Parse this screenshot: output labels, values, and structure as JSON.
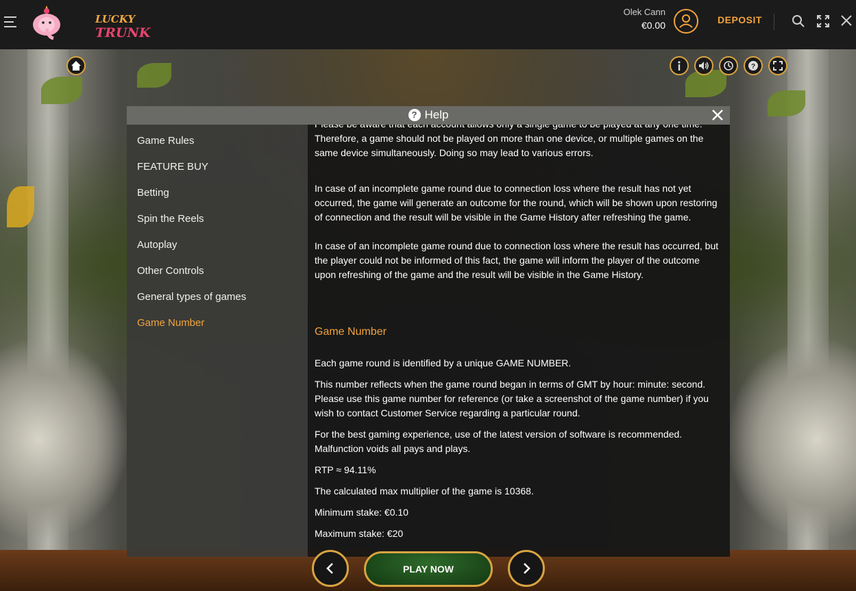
{
  "header": {
    "logo_line1": "LUCKY",
    "logo_line2": "TRUNK",
    "user_name": "Olek Cann",
    "balance": "€0.00",
    "deposit_label": "DEPOSIT"
  },
  "game_icons": {
    "home": "home-icon",
    "right": [
      "info-icon",
      "sound-icon",
      "history-icon",
      "help-icon",
      "fullscreen-icon"
    ]
  },
  "help": {
    "title": "Help",
    "nav": [
      {
        "label": "Game Rules",
        "active": false
      },
      {
        "label": "FEATURE BUY",
        "active": false
      },
      {
        "label": "Betting",
        "active": false
      },
      {
        "label": "Spin the Reels",
        "active": false
      },
      {
        "label": "Autoplay",
        "active": false
      },
      {
        "label": "Other Controls",
        "active": false
      },
      {
        "label": "General types of games",
        "active": false
      },
      {
        "label": "Game Number",
        "active": true
      }
    ],
    "content": {
      "p_partial": "Please be aware that each account allows only a single game to be played at any one time. Therefore, a game should not be played on more than one device, or multiple games on the same device simultaneously. Doing so may lead to various errors.",
      "p_incomplete_1": "In case of an incomplete game round due to connection loss where the result has not yet occurred, the game will generate an outcome for the round, which will be shown upon restoring of connection and the result will be visible in the Game History after refreshing the game.",
      "p_incomplete_2": "In case of an incomplete game round due to connection loss where the result has occurred, but the player could not be informed of this fact, the game will inform the player of the outcome upon refreshing of the game and the result will be visible in the Game History.",
      "section_title": "Game Number",
      "p_game_number": "Each game round is identified by a unique GAME NUMBER.",
      "p_gmt": "This number reflects when the game round began in terms of GMT by hour: minute: second. Please use this game number for reference (or take a screenshot of the game number) if you wish to contact Customer Service regarding a particular round.",
      "p_software": "For the best gaming experience, use of the latest version of software is recommended. Malfunction voids all pays and plays.",
      "p_rtp": "RTP ≈ 94.11%",
      "p_multiplier": "The calculated max multiplier of the game is 10368.",
      "p_min_stake": "Minimum stake: €0.10",
      "p_max_stake": "Maximum stake: €20"
    }
  },
  "bottom": {
    "play_label": "PLAY NOW"
  },
  "colors": {
    "accent": "#f2a33c",
    "gold_border": "#d9a441",
    "play_green": "#1f5a1c"
  }
}
